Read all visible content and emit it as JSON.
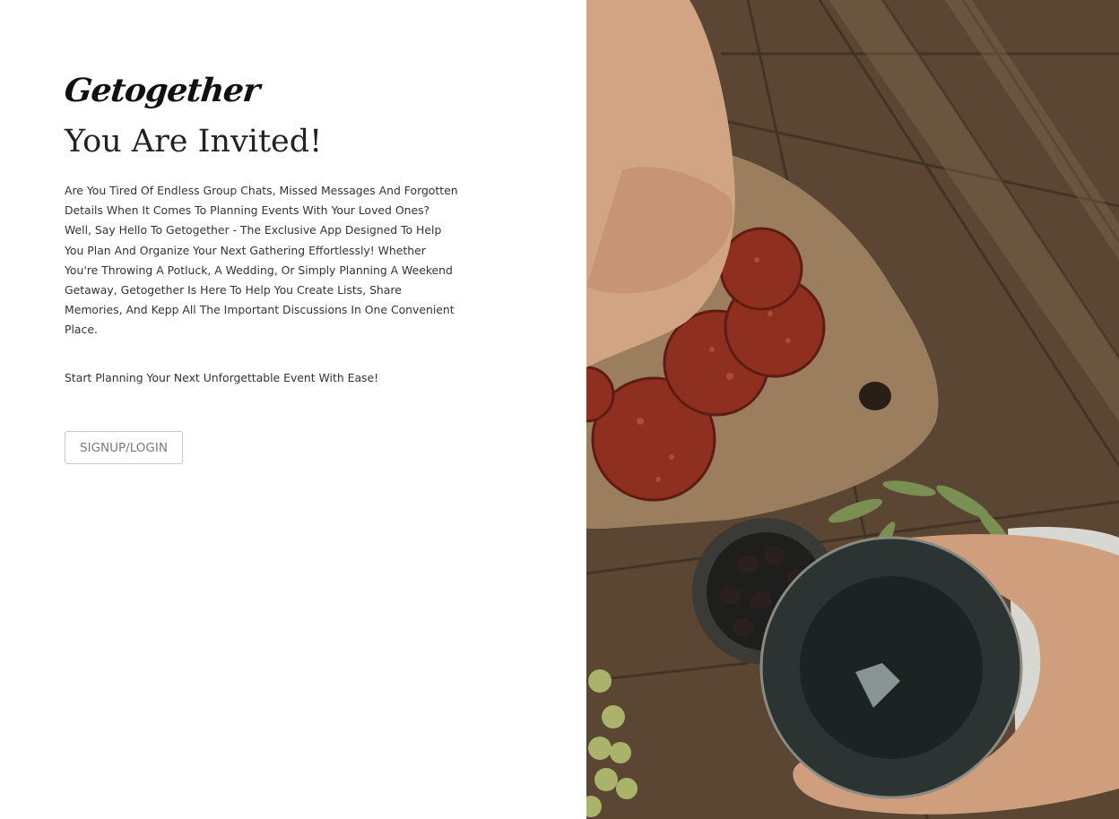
{
  "brand": {
    "name": "Getogether"
  },
  "hero": {
    "title": "You Are Invited!",
    "description": "Are You Tired Of Endless Group Chats, Missed Messages And Forgotten Details When It Comes To Planning Events With Your Loved Ones? Well, Say Hello To Getogether - The Exclusive App Designed To Help You Plan And Organize Your Next Gathering Effortlessly! Whether You're Throwing A Potluck, A Wedding, Or Simply Planning A Weekend Getaway, Getogether Is Here To Help You Create Lists, Share Memories, And Kepp All The Important Discussions In One Convenient Place.",
    "tagline": "Start Planning Your Next Unforgettable Event With Ease!",
    "cta_label": "SIGNUP/LOGIN"
  },
  "photo": {
    "subject": "hands-with-wine-glass-and-charcuterie-board-on-wooden-table"
  },
  "colors": {
    "background": "#ffffff",
    "text": "#222222",
    "button_border": "#c8c8c8",
    "button_text": "#7a7a7a",
    "wood": "#574430",
    "wine": "#1b2422",
    "salami": "#8e2f1f"
  }
}
